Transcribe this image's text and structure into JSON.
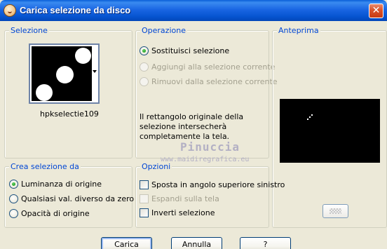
{
  "window": {
    "title": "Carica selezione da disco",
    "close_label": "✕"
  },
  "selection": {
    "legend": "Selezione",
    "name": "hpkselectie109"
  },
  "operation": {
    "legend": "Operazione",
    "options": [
      {
        "label": "Sostituisci selezione",
        "checked": true,
        "disabled": false
      },
      {
        "label": "Aggiungi alla selezione corrente",
        "checked": false,
        "disabled": true
      },
      {
        "label": "Rimuovi dalla selezione corrente",
        "checked": false,
        "disabled": true
      }
    ],
    "description": "Il rettangolo originale della selezione intersecherà completamente la tela."
  },
  "preview": {
    "legend": "Anteprima"
  },
  "create_from": {
    "legend": "Crea selezione da",
    "options": [
      {
        "label": "Luminanza di origine",
        "checked": true
      },
      {
        "label": "Qualsiasi val. diverso da zero",
        "checked": false
      },
      {
        "label": "Opacità di origine",
        "checked": false
      }
    ]
  },
  "options": {
    "legend": "Opzioni",
    "items": [
      {
        "label": "Sposta in angolo superiore sinistro",
        "checked": false,
        "disabled": false
      },
      {
        "label": "Espandi sulla tela",
        "checked": false,
        "disabled": true
      },
      {
        "label": "Inverti selezione",
        "checked": false,
        "disabled": false
      }
    ]
  },
  "watermark": {
    "line1": "Pinuccia",
    "line2": "www.maidiregrafica.eu"
  },
  "buttons": {
    "load": "Carica",
    "cancel": "Annulla",
    "help": "?"
  },
  "colors": {
    "legend_text": "#0046d5",
    "titlebar": "#0553cf",
    "dialog_bg": "#ece9d8"
  }
}
